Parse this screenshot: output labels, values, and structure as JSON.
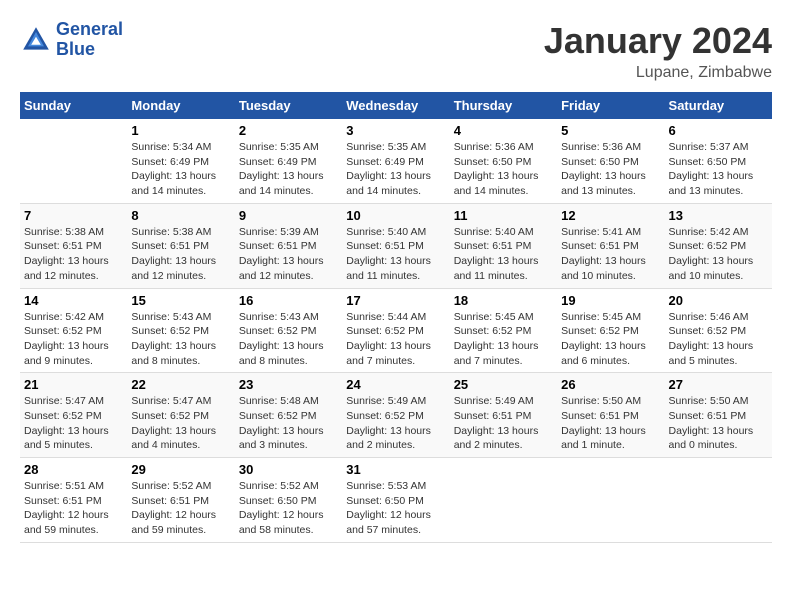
{
  "header": {
    "logo_line1": "General",
    "logo_line2": "Blue",
    "month": "January 2024",
    "location": "Lupane, Zimbabwe"
  },
  "columns": [
    "Sunday",
    "Monday",
    "Tuesday",
    "Wednesday",
    "Thursday",
    "Friday",
    "Saturday"
  ],
  "weeks": [
    [
      {
        "day": "",
        "sunrise": "",
        "sunset": "",
        "daylight": ""
      },
      {
        "day": "1",
        "sunrise": "Sunrise: 5:34 AM",
        "sunset": "Sunset: 6:49 PM",
        "daylight": "Daylight: 13 hours and 14 minutes."
      },
      {
        "day": "2",
        "sunrise": "Sunrise: 5:35 AM",
        "sunset": "Sunset: 6:49 PM",
        "daylight": "Daylight: 13 hours and 14 minutes."
      },
      {
        "day": "3",
        "sunrise": "Sunrise: 5:35 AM",
        "sunset": "Sunset: 6:49 PM",
        "daylight": "Daylight: 13 hours and 14 minutes."
      },
      {
        "day": "4",
        "sunrise": "Sunrise: 5:36 AM",
        "sunset": "Sunset: 6:50 PM",
        "daylight": "Daylight: 13 hours and 14 minutes."
      },
      {
        "day": "5",
        "sunrise": "Sunrise: 5:36 AM",
        "sunset": "Sunset: 6:50 PM",
        "daylight": "Daylight: 13 hours and 13 minutes."
      },
      {
        "day": "6",
        "sunrise": "Sunrise: 5:37 AM",
        "sunset": "Sunset: 6:50 PM",
        "daylight": "Daylight: 13 hours and 13 minutes."
      }
    ],
    [
      {
        "day": "7",
        "sunrise": "Sunrise: 5:38 AM",
        "sunset": "Sunset: 6:51 PM",
        "daylight": "Daylight: 13 hours and 12 minutes."
      },
      {
        "day": "8",
        "sunrise": "Sunrise: 5:38 AM",
        "sunset": "Sunset: 6:51 PM",
        "daylight": "Daylight: 13 hours and 12 minutes."
      },
      {
        "day": "9",
        "sunrise": "Sunrise: 5:39 AM",
        "sunset": "Sunset: 6:51 PM",
        "daylight": "Daylight: 13 hours and 12 minutes."
      },
      {
        "day": "10",
        "sunrise": "Sunrise: 5:40 AM",
        "sunset": "Sunset: 6:51 PM",
        "daylight": "Daylight: 13 hours and 11 minutes."
      },
      {
        "day": "11",
        "sunrise": "Sunrise: 5:40 AM",
        "sunset": "Sunset: 6:51 PM",
        "daylight": "Daylight: 13 hours and 11 minutes."
      },
      {
        "day": "12",
        "sunrise": "Sunrise: 5:41 AM",
        "sunset": "Sunset: 6:51 PM",
        "daylight": "Daylight: 13 hours and 10 minutes."
      },
      {
        "day": "13",
        "sunrise": "Sunrise: 5:42 AM",
        "sunset": "Sunset: 6:52 PM",
        "daylight": "Daylight: 13 hours and 10 minutes."
      }
    ],
    [
      {
        "day": "14",
        "sunrise": "Sunrise: 5:42 AM",
        "sunset": "Sunset: 6:52 PM",
        "daylight": "Daylight: 13 hours and 9 minutes."
      },
      {
        "day": "15",
        "sunrise": "Sunrise: 5:43 AM",
        "sunset": "Sunset: 6:52 PM",
        "daylight": "Daylight: 13 hours and 8 minutes."
      },
      {
        "day": "16",
        "sunrise": "Sunrise: 5:43 AM",
        "sunset": "Sunset: 6:52 PM",
        "daylight": "Daylight: 13 hours and 8 minutes."
      },
      {
        "day": "17",
        "sunrise": "Sunrise: 5:44 AM",
        "sunset": "Sunset: 6:52 PM",
        "daylight": "Daylight: 13 hours and 7 minutes."
      },
      {
        "day": "18",
        "sunrise": "Sunrise: 5:45 AM",
        "sunset": "Sunset: 6:52 PM",
        "daylight": "Daylight: 13 hours and 7 minutes."
      },
      {
        "day": "19",
        "sunrise": "Sunrise: 5:45 AM",
        "sunset": "Sunset: 6:52 PM",
        "daylight": "Daylight: 13 hours and 6 minutes."
      },
      {
        "day": "20",
        "sunrise": "Sunrise: 5:46 AM",
        "sunset": "Sunset: 6:52 PM",
        "daylight": "Daylight: 13 hours and 5 minutes."
      }
    ],
    [
      {
        "day": "21",
        "sunrise": "Sunrise: 5:47 AM",
        "sunset": "Sunset: 6:52 PM",
        "daylight": "Daylight: 13 hours and 5 minutes."
      },
      {
        "day": "22",
        "sunrise": "Sunrise: 5:47 AM",
        "sunset": "Sunset: 6:52 PM",
        "daylight": "Daylight: 13 hours and 4 minutes."
      },
      {
        "day": "23",
        "sunrise": "Sunrise: 5:48 AM",
        "sunset": "Sunset: 6:52 PM",
        "daylight": "Daylight: 13 hours and 3 minutes."
      },
      {
        "day": "24",
        "sunrise": "Sunrise: 5:49 AM",
        "sunset": "Sunset: 6:52 PM",
        "daylight": "Daylight: 13 hours and 2 minutes."
      },
      {
        "day": "25",
        "sunrise": "Sunrise: 5:49 AM",
        "sunset": "Sunset: 6:51 PM",
        "daylight": "Daylight: 13 hours and 2 minutes."
      },
      {
        "day": "26",
        "sunrise": "Sunrise: 5:50 AM",
        "sunset": "Sunset: 6:51 PM",
        "daylight": "Daylight: 13 hours and 1 minute."
      },
      {
        "day": "27",
        "sunrise": "Sunrise: 5:50 AM",
        "sunset": "Sunset: 6:51 PM",
        "daylight": "Daylight: 13 hours and 0 minutes."
      }
    ],
    [
      {
        "day": "28",
        "sunrise": "Sunrise: 5:51 AM",
        "sunset": "Sunset: 6:51 PM",
        "daylight": "Daylight: 12 hours and 59 minutes."
      },
      {
        "day": "29",
        "sunrise": "Sunrise: 5:52 AM",
        "sunset": "Sunset: 6:51 PM",
        "daylight": "Daylight: 12 hours and 59 minutes."
      },
      {
        "day": "30",
        "sunrise": "Sunrise: 5:52 AM",
        "sunset": "Sunset: 6:50 PM",
        "daylight": "Daylight: 12 hours and 58 minutes."
      },
      {
        "day": "31",
        "sunrise": "Sunrise: 5:53 AM",
        "sunset": "Sunset: 6:50 PM",
        "daylight": "Daylight: 12 hours and 57 minutes."
      },
      {
        "day": "",
        "sunrise": "",
        "sunset": "",
        "daylight": ""
      },
      {
        "day": "",
        "sunrise": "",
        "sunset": "",
        "daylight": ""
      },
      {
        "day": "",
        "sunrise": "",
        "sunset": "",
        "daylight": ""
      }
    ]
  ]
}
